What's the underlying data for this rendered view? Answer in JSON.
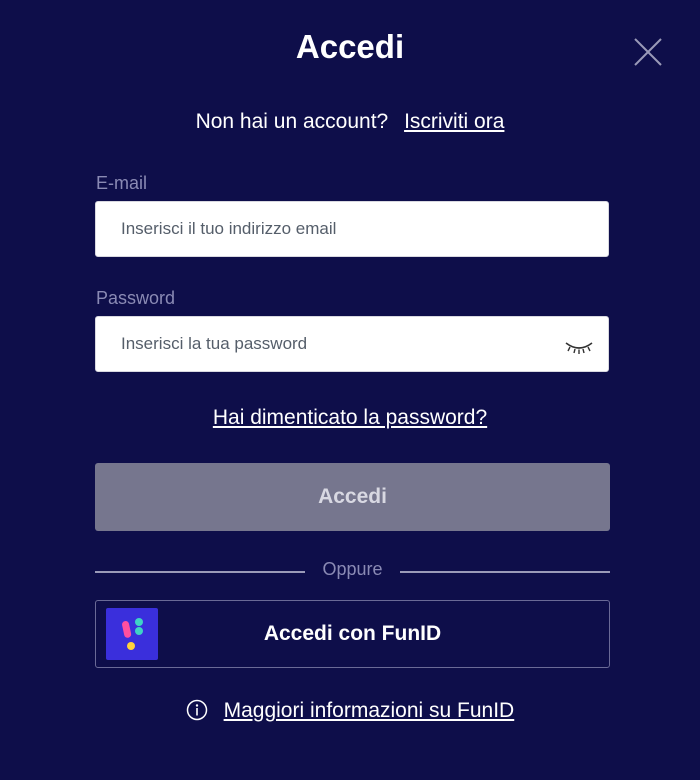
{
  "modal": {
    "title": "Accedi",
    "close_icon": "close-icon"
  },
  "signup": {
    "question": "Non hai un account?",
    "link": "Iscriviti ora"
  },
  "email": {
    "label": "E-mail",
    "value": "",
    "placeholder": "Inserisci il tuo indirizzo email"
  },
  "password": {
    "label": "Password",
    "value": "",
    "placeholder": "Inserisci la tua password",
    "toggle_icon": "eye-closed-icon"
  },
  "forgot_password": "Hai dimenticato la password?",
  "login_button": "Accedi",
  "divider": "Oppure",
  "funid": {
    "button_label": "Accedi con FunID",
    "logo_icon": "funid-logo-icon"
  },
  "more_info": {
    "icon": "info-icon",
    "link": "Maggiori informazioni su FunID"
  },
  "colors": {
    "background": "#0e0e4a",
    "button_disabled": "#76768e",
    "label_muted": "#8a8ab4",
    "funid_brand": "#3a2fdc"
  }
}
